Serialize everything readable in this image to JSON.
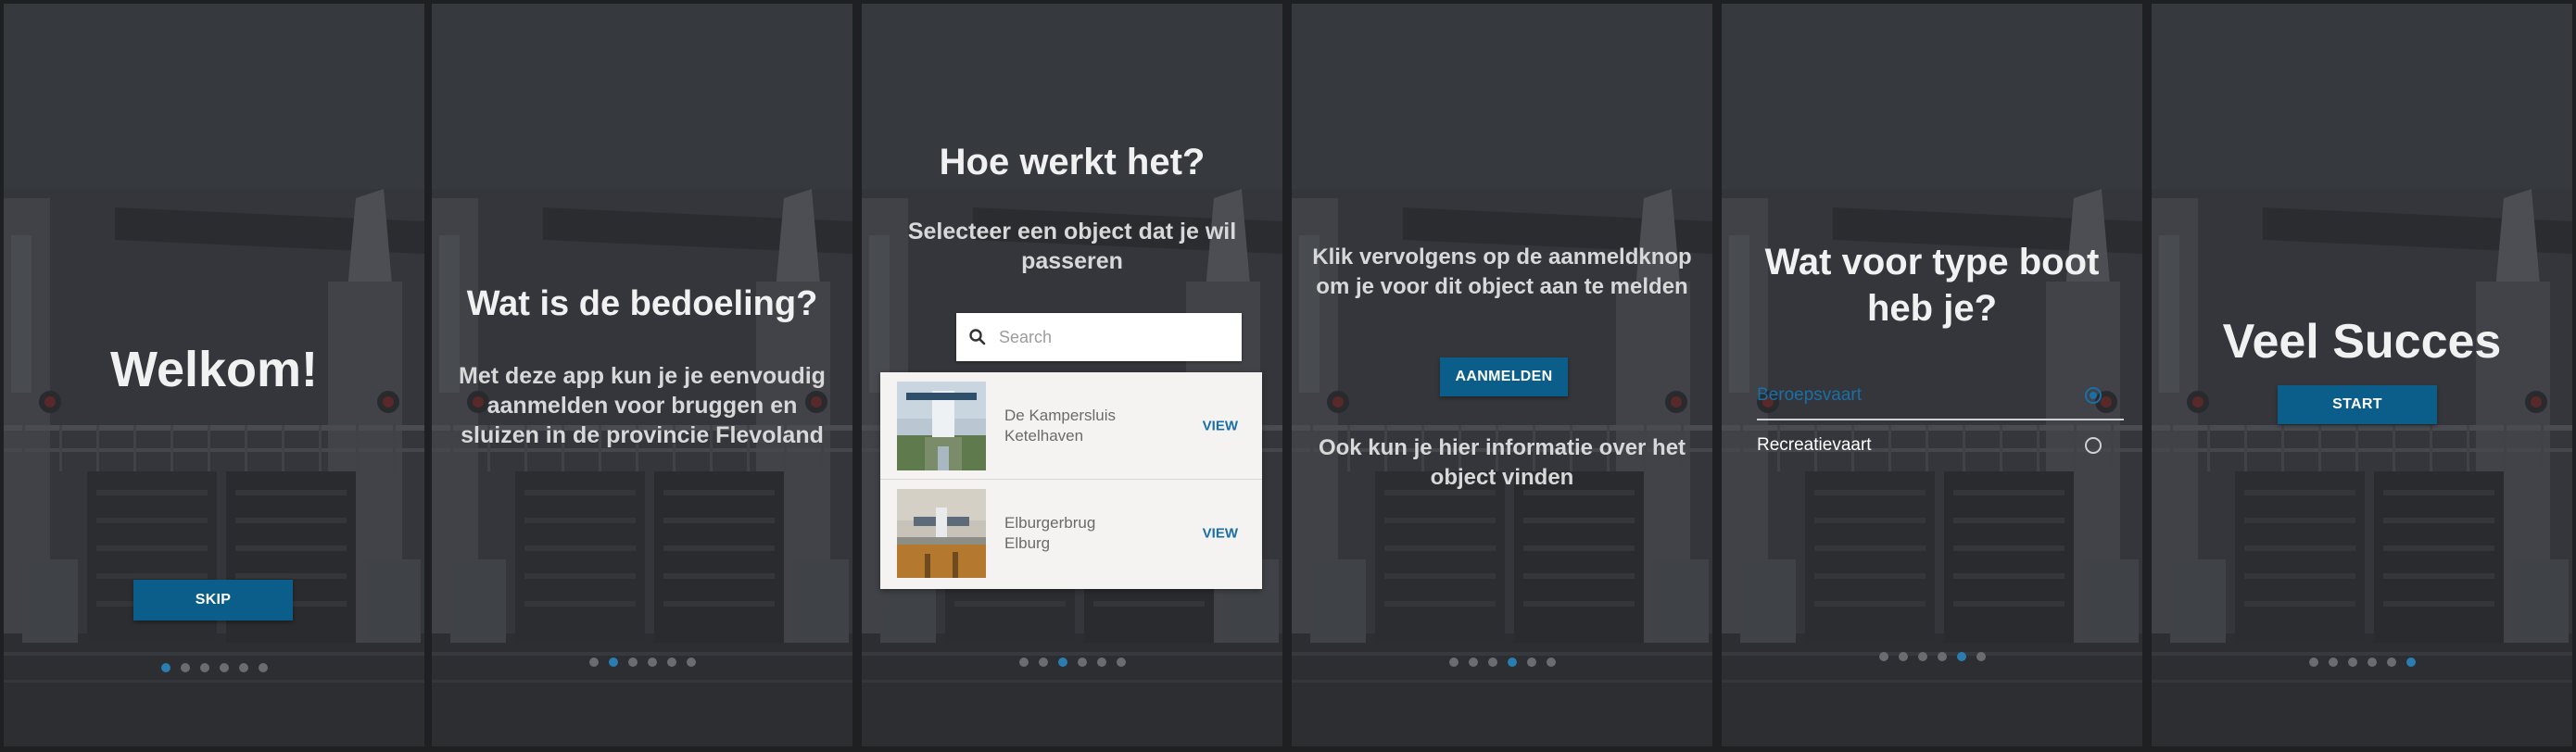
{
  "colors": {
    "accent": "#0b5e8a",
    "link": "#1a6fa5",
    "dot_inactive": "#6a6c70",
    "dot_active": "#2a7db0"
  },
  "screens": [
    {
      "title": "Welkom!",
      "button": "SKIP",
      "active_dot": 0
    },
    {
      "title": "Wat is de bedoeling?",
      "body": "Met deze app kun je je eenvoudig aanmelden voor bruggen en sluizen in de provincie Flevoland",
      "active_dot": 1
    },
    {
      "title": "Hoe werkt het?",
      "body": "Selecteer een object dat je wil passeren",
      "search": {
        "placeholder": "Search",
        "icon": "search-icon"
      },
      "items": [
        {
          "name": "De Kampersluis",
          "place": "Ketelhaven",
          "action": "VIEW"
        },
        {
          "name": "Elburgerbrug",
          "place": "Elburg",
          "action": "VIEW"
        }
      ],
      "active_dot": 2
    },
    {
      "body": "Klik vervolgens op de aanmeldknop om je voor dit object aan te melden",
      "button": "AANMELDEN",
      "body2": "Ook kun je hier informatie over het object vinden",
      "active_dot": 3
    },
    {
      "title": "Wat voor type boot heb je?",
      "options": [
        {
          "label": "Beroepsvaart",
          "selected": true
        },
        {
          "label": "Recreatievaart",
          "selected": false
        }
      ],
      "active_dot": 4
    },
    {
      "title": "Veel Succes",
      "button": "START",
      "active_dot": 5
    }
  ]
}
